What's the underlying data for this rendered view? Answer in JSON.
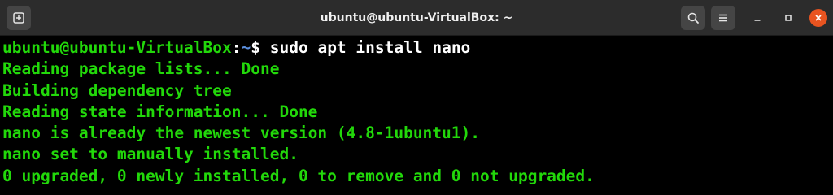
{
  "window": {
    "title": "ubuntu@ubuntu-VirtualBox: ~"
  },
  "titlebar": {
    "new_tab_icon": "new-tab-icon",
    "search_icon": "search-icon",
    "menu_icon": "hamburger-menu-icon",
    "minimize_icon": "minimize-icon",
    "maximize_icon": "maximize-icon",
    "close_icon": "close-icon",
    "close_color": "#e95420"
  },
  "terminal": {
    "prompt": {
      "user_host": "ubuntu@ubuntu-VirtualBox",
      "separator": ":",
      "path": "~",
      "symbol": "$",
      "command": " sudo apt install nano"
    },
    "output_lines": [
      "Reading package lists... Done",
      "Building dependency tree",
      "Reading state information... Done",
      "nano is already the newest version (4.8-1ubuntu1).",
      "nano set to manually installed.",
      "0 upgraded, 0 newly installed, 0 to remove and 0 not upgraded."
    ],
    "colors": {
      "background": "#000000",
      "text": "#22d80a",
      "path": "#5b8fde",
      "command": "#ffffff"
    }
  }
}
